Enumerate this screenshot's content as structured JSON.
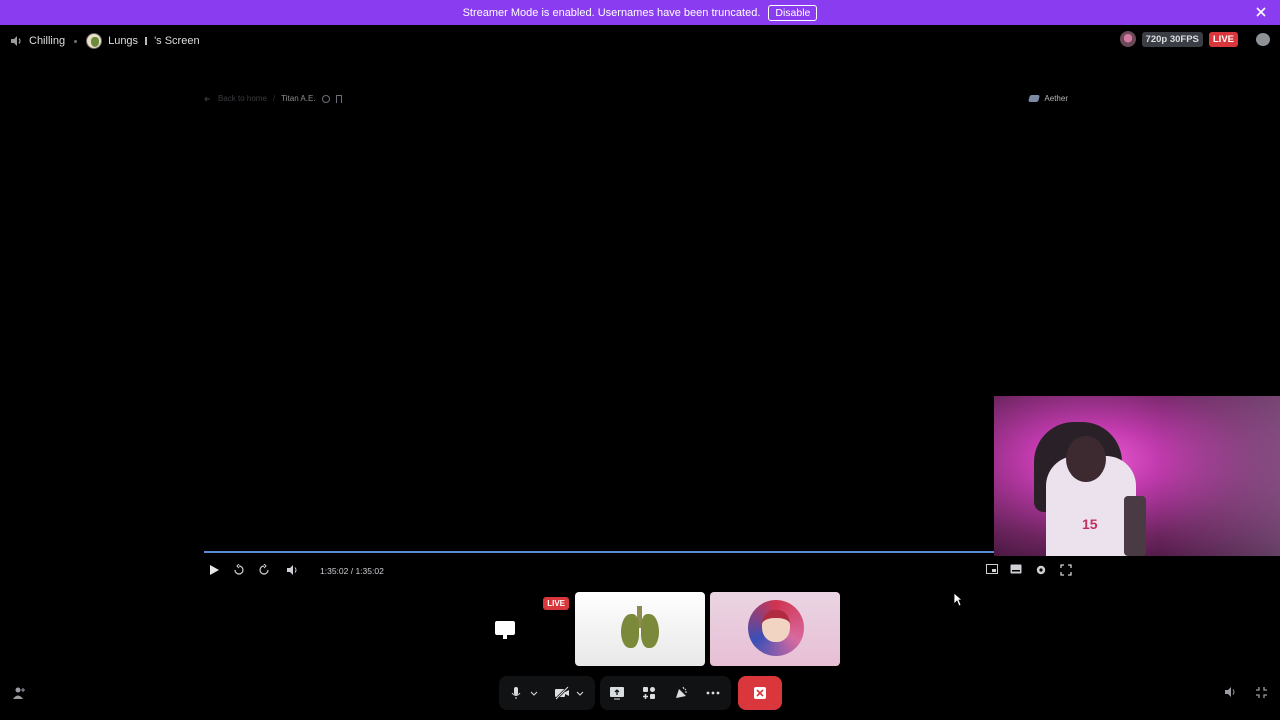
{
  "banner": {
    "message": "Streamer Mode is enabled. Usernames have been truncated.",
    "disable_label": "Disable"
  },
  "header": {
    "channel_name": "Chilling",
    "stream_title_user": "Lungs",
    "stream_title_suffix": "'s Screen",
    "quality": "720p 30FPS",
    "live_label": "LIVE"
  },
  "player": {
    "breadcrumb_back": "Back to home",
    "breadcrumb_sep": "/",
    "title": "Titan A.E.",
    "brand": "Aether",
    "time": "1:35:02 / 1:35:02",
    "progress_fraction": 1.0
  },
  "tiles": {
    "screen_live_label": "LIVE"
  },
  "colors": {
    "banner": "#8a3df0",
    "live": "#da373c",
    "progress": "#5b8bd6",
    "dock": "#111214"
  }
}
